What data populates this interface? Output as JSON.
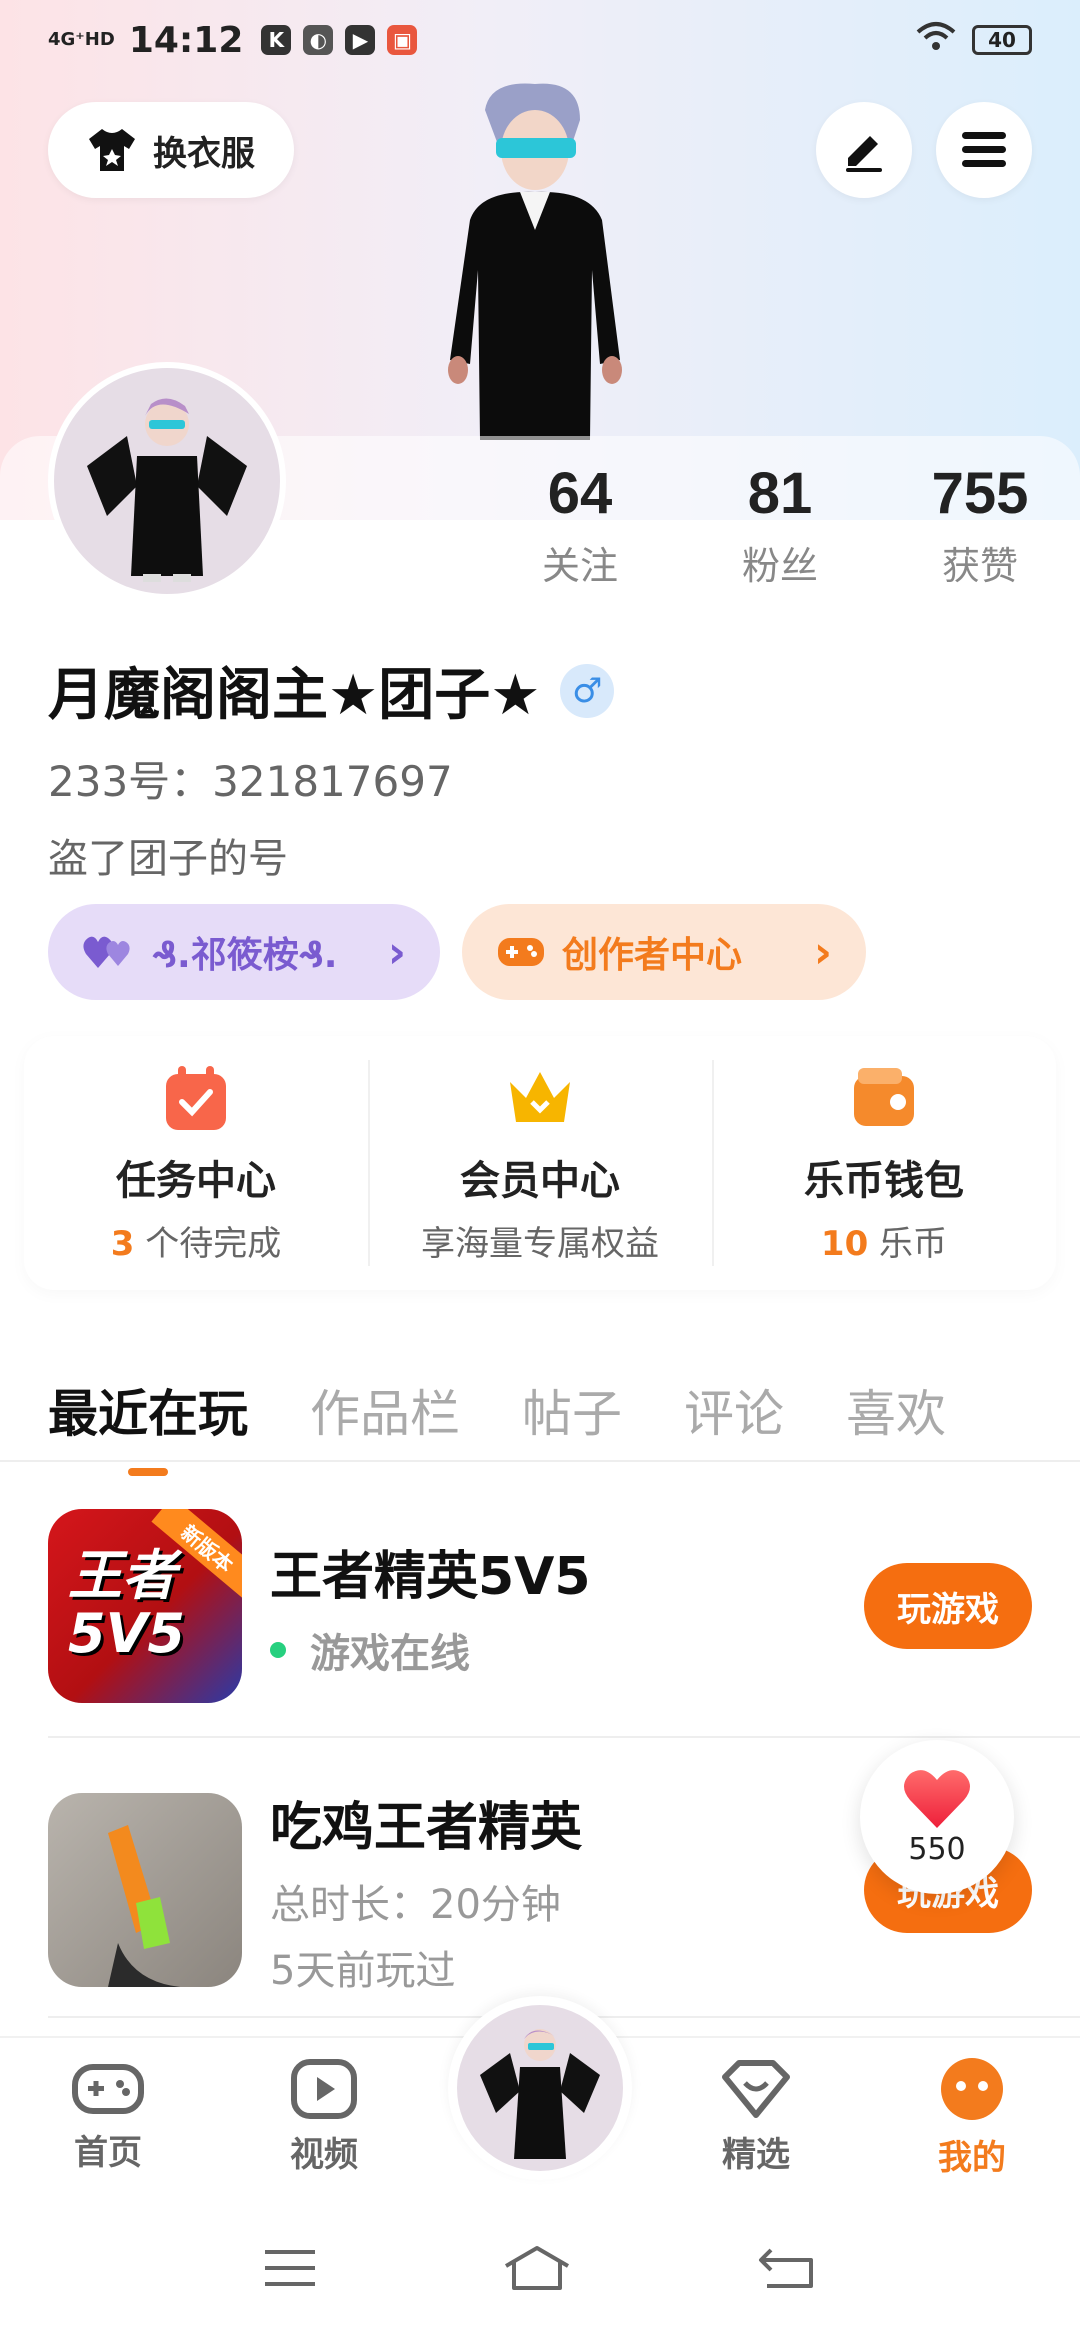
{
  "status_bar": {
    "network": "4G⁺HD",
    "time": "14:12",
    "battery": "40"
  },
  "header": {
    "outfit_label": "换衣服"
  },
  "profile": {
    "stats": [
      {
        "value": "64",
        "label": "关注"
      },
      {
        "value": "81",
        "label": "粉丝"
      },
      {
        "value": "755",
        "label": "获赞"
      }
    ],
    "name": "月魔阁阁主★团子★",
    "uid": "233号：321817697",
    "bio": "盗了团子的号",
    "gender_symbol": "♂"
  },
  "badges": {
    "guild": "₰.祁筱桉₰.",
    "creator": "创作者中心",
    "chevron": "›"
  },
  "services": [
    {
      "title": "任务中心",
      "count": "3",
      "suffix": " 个待完成",
      "icon": "task-calendar-icon"
    },
    {
      "title": "会员中心",
      "subtitle": "享海量专属权益",
      "icon": "crown-icon"
    },
    {
      "title": "乐币钱包",
      "count": "10",
      "suffix": " 乐币",
      "icon": "wallet-icon"
    }
  ],
  "tabs": [
    "最近在玩",
    "作品栏",
    "帖子",
    "评论",
    "喜欢"
  ],
  "games": [
    {
      "title": "王者精英5V5",
      "status": "游戏在线",
      "button": "玩游戏",
      "thumb_text": "王者\n5V5",
      "badge": "新版本"
    },
    {
      "title": "吃鸡王者精英",
      "duration": "总时长：20分钟",
      "last_played": "5天前玩过",
      "button": "玩游戏"
    }
  ],
  "like_bubble": {
    "count": "550"
  },
  "bottom_nav": [
    {
      "label": "首页",
      "icon": "gamepad-icon"
    },
    {
      "label": "视频",
      "icon": "video-play-icon"
    },
    {
      "label": "精选",
      "icon": "heart-diamond-icon"
    },
    {
      "label": "我的",
      "icon": "profile-face-icon"
    }
  ],
  "colors": {
    "accent": "#F37B1D",
    "online": "#27B97A",
    "purple": "#7A5BD0"
  }
}
